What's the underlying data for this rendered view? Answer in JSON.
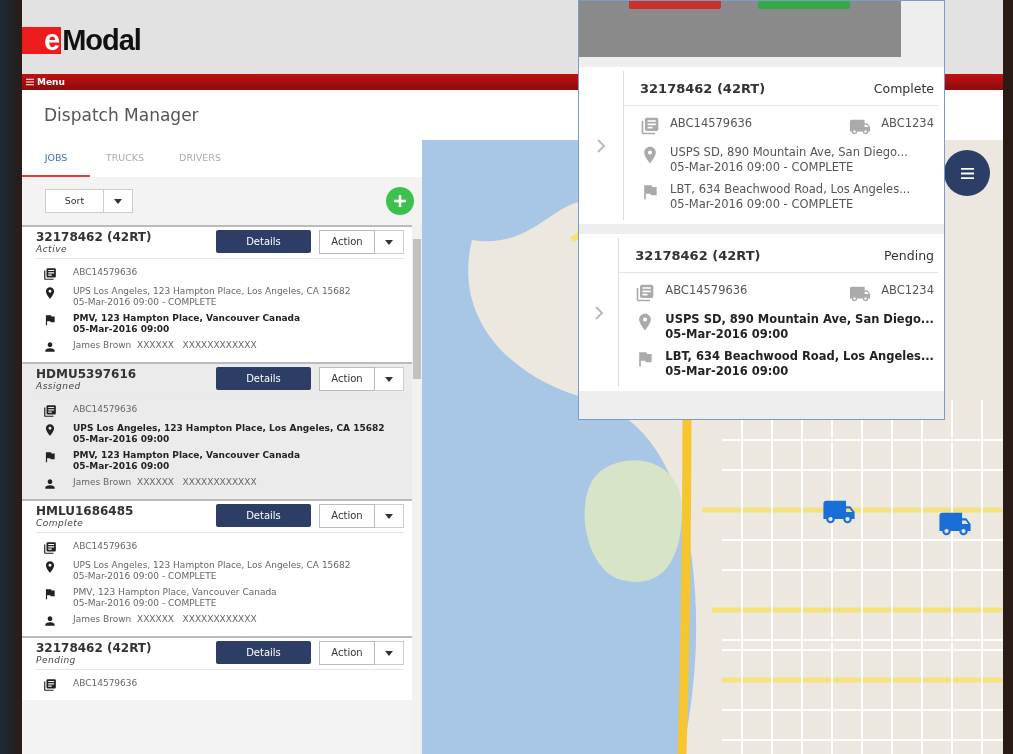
{
  "logo": {
    "mark": "e",
    "name": "Modal"
  },
  "menu": {
    "label": "Menu"
  },
  "page_title": "Dispatch Manager",
  "tabs": [
    {
      "label": "JOBS",
      "selected": true
    },
    {
      "label": "TRUCKS",
      "selected": false
    },
    {
      "label": "DRIVERS",
      "selected": false
    }
  ],
  "sort": {
    "label": "Sort"
  },
  "jobs": [
    {
      "id": "32178462 (42RT)",
      "status": "Active",
      "selected": false,
      "lines": [
        {
          "kind": "container",
          "bold": false,
          "text": [
            "ABC14579636"
          ]
        },
        {
          "kind": "pickup",
          "bold": false,
          "text": [
            "UPS Los Angeles, 123 Hampton Place, Los Angeles, CA 15682",
            "05-Mar-2016 09:00 - COMPLETE"
          ]
        },
        {
          "kind": "delivery",
          "bold": true,
          "text": [
            "PMV, 123 Hampton Place, Vancouver Canada",
            "05-Mar-2016 09:00"
          ]
        },
        {
          "kind": "driver",
          "bold": false,
          "text": [
            "James Brown  XXXXXX   XXXXXXXXXXXX"
          ]
        }
      ]
    },
    {
      "id": "HDMU5397616",
      "status": "Assigned",
      "selected": true,
      "lines": [
        {
          "kind": "container",
          "bold": false,
          "text": [
            "ABC14579636"
          ]
        },
        {
          "kind": "pickup",
          "bold": true,
          "text": [
            "UPS Los Angeles, 123 Hampton Place, Los Angeles, CA 15682",
            "05-Mar-2016 09:00"
          ]
        },
        {
          "kind": "delivery",
          "bold": true,
          "text": [
            "PMV, 123 Hampton Place, Vancouver Canada",
            "05-Mar-2016 09:00"
          ]
        },
        {
          "kind": "driver",
          "bold": false,
          "text": [
            "James Brown  XXXXXX   XXXXXXXXXXXX"
          ]
        }
      ]
    },
    {
      "id": "HMLU1686485",
      "status": "Complete",
      "selected": false,
      "lines": [
        {
          "kind": "container",
          "bold": false,
          "text": [
            "ABC14579636"
          ]
        },
        {
          "kind": "pickup",
          "bold": false,
          "text": [
            "UPS Los Angeles, 123 Hampton Place, Los Angeles, CA 15682",
            "05-Mar-2016 09:00 - COMPLETE"
          ]
        },
        {
          "kind": "delivery",
          "bold": false,
          "text": [
            "PMV, 123 Hampton Place, Vancouver Canada",
            "05-Mar-2016 09:00 - COMPLETE"
          ]
        },
        {
          "kind": "driver",
          "bold": false,
          "text": [
            "James Brown  XXXXXX   XXXXXXXXXXXX"
          ]
        }
      ]
    },
    {
      "id": "32178462 (42RT)",
      "status": "Pending",
      "selected": false,
      "lines": [
        {
          "kind": "container",
          "bold": false,
          "text": [
            "ABC14579636"
          ]
        }
      ]
    }
  ],
  "job_buttons": [
    {
      "details": "Details",
      "action": "Action"
    },
    {
      "details": "Details",
      "action": "Action"
    },
    {
      "details": "Details",
      "action": "Action"
    },
    {
      "details": "Details",
      "action": "Action"
    }
  ],
  "popup_cards": [
    {
      "id": "32178462 (42RT)",
      "status": "Complete",
      "bold": false,
      "container": "ABC14579636",
      "truck": "ABC1234",
      "pickup": [
        "USPS SD, 890 Mountain Ave, San Diego...",
        "05-Mar-2016 09:00 - COMPLETE"
      ],
      "delivery": [
        "LBT, 634 Beachwood Road, Los Angeles...",
        "05-Mar-2016 09:00 - COMPLETE"
      ]
    },
    {
      "id": "32178462 (42RT)",
      "status": "Pending",
      "bold": true,
      "container": "ABC14579636",
      "truck": "ABC1234",
      "pickup": [
        "USPS SD, 890 Mountain Ave, San Diego...",
        "05-Mar-2016 09:00"
      ],
      "delivery": [
        "LBT, 634 Beachwood Road, Los Angeles...",
        "05-Mar-2016 09:00"
      ]
    }
  ]
}
